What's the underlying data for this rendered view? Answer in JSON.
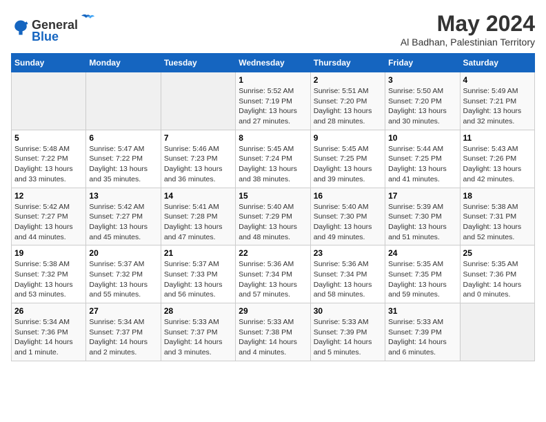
{
  "header": {
    "logo_general": "General",
    "logo_blue": "Blue",
    "month_year": "May 2024",
    "location": "Al Badhan, Palestinian Territory"
  },
  "days_of_week": [
    "Sunday",
    "Monday",
    "Tuesday",
    "Wednesday",
    "Thursday",
    "Friday",
    "Saturday"
  ],
  "weeks": [
    [
      {
        "day": "",
        "sunrise": "",
        "sunset": "",
        "daylight": ""
      },
      {
        "day": "",
        "sunrise": "",
        "sunset": "",
        "daylight": ""
      },
      {
        "day": "",
        "sunrise": "",
        "sunset": "",
        "daylight": ""
      },
      {
        "day": "1",
        "sunrise": "Sunrise: 5:52 AM",
        "sunset": "Sunset: 7:19 PM",
        "daylight": "Daylight: 13 hours and 27 minutes."
      },
      {
        "day": "2",
        "sunrise": "Sunrise: 5:51 AM",
        "sunset": "Sunset: 7:20 PM",
        "daylight": "Daylight: 13 hours and 28 minutes."
      },
      {
        "day": "3",
        "sunrise": "Sunrise: 5:50 AM",
        "sunset": "Sunset: 7:20 PM",
        "daylight": "Daylight: 13 hours and 30 minutes."
      },
      {
        "day": "4",
        "sunrise": "Sunrise: 5:49 AM",
        "sunset": "Sunset: 7:21 PM",
        "daylight": "Daylight: 13 hours and 32 minutes."
      }
    ],
    [
      {
        "day": "5",
        "sunrise": "Sunrise: 5:48 AM",
        "sunset": "Sunset: 7:22 PM",
        "daylight": "Daylight: 13 hours and 33 minutes."
      },
      {
        "day": "6",
        "sunrise": "Sunrise: 5:47 AM",
        "sunset": "Sunset: 7:22 PM",
        "daylight": "Daylight: 13 hours and 35 minutes."
      },
      {
        "day": "7",
        "sunrise": "Sunrise: 5:46 AM",
        "sunset": "Sunset: 7:23 PM",
        "daylight": "Daylight: 13 hours and 36 minutes."
      },
      {
        "day": "8",
        "sunrise": "Sunrise: 5:45 AM",
        "sunset": "Sunset: 7:24 PM",
        "daylight": "Daylight: 13 hours and 38 minutes."
      },
      {
        "day": "9",
        "sunrise": "Sunrise: 5:45 AM",
        "sunset": "Sunset: 7:25 PM",
        "daylight": "Daylight: 13 hours and 39 minutes."
      },
      {
        "day": "10",
        "sunrise": "Sunrise: 5:44 AM",
        "sunset": "Sunset: 7:25 PM",
        "daylight": "Daylight: 13 hours and 41 minutes."
      },
      {
        "day": "11",
        "sunrise": "Sunrise: 5:43 AM",
        "sunset": "Sunset: 7:26 PM",
        "daylight": "Daylight: 13 hours and 42 minutes."
      }
    ],
    [
      {
        "day": "12",
        "sunrise": "Sunrise: 5:42 AM",
        "sunset": "Sunset: 7:27 PM",
        "daylight": "Daylight: 13 hours and 44 minutes."
      },
      {
        "day": "13",
        "sunrise": "Sunrise: 5:42 AM",
        "sunset": "Sunset: 7:27 PM",
        "daylight": "Daylight: 13 hours and 45 minutes."
      },
      {
        "day": "14",
        "sunrise": "Sunrise: 5:41 AM",
        "sunset": "Sunset: 7:28 PM",
        "daylight": "Daylight: 13 hours and 47 minutes."
      },
      {
        "day": "15",
        "sunrise": "Sunrise: 5:40 AM",
        "sunset": "Sunset: 7:29 PM",
        "daylight": "Daylight: 13 hours and 48 minutes."
      },
      {
        "day": "16",
        "sunrise": "Sunrise: 5:40 AM",
        "sunset": "Sunset: 7:30 PM",
        "daylight": "Daylight: 13 hours and 49 minutes."
      },
      {
        "day": "17",
        "sunrise": "Sunrise: 5:39 AM",
        "sunset": "Sunset: 7:30 PM",
        "daylight": "Daylight: 13 hours and 51 minutes."
      },
      {
        "day": "18",
        "sunrise": "Sunrise: 5:38 AM",
        "sunset": "Sunset: 7:31 PM",
        "daylight": "Daylight: 13 hours and 52 minutes."
      }
    ],
    [
      {
        "day": "19",
        "sunrise": "Sunrise: 5:38 AM",
        "sunset": "Sunset: 7:32 PM",
        "daylight": "Daylight: 13 hours and 53 minutes."
      },
      {
        "day": "20",
        "sunrise": "Sunrise: 5:37 AM",
        "sunset": "Sunset: 7:32 PM",
        "daylight": "Daylight: 13 hours and 55 minutes."
      },
      {
        "day": "21",
        "sunrise": "Sunrise: 5:37 AM",
        "sunset": "Sunset: 7:33 PM",
        "daylight": "Daylight: 13 hours and 56 minutes."
      },
      {
        "day": "22",
        "sunrise": "Sunrise: 5:36 AM",
        "sunset": "Sunset: 7:34 PM",
        "daylight": "Daylight: 13 hours and 57 minutes."
      },
      {
        "day": "23",
        "sunrise": "Sunrise: 5:36 AM",
        "sunset": "Sunset: 7:34 PM",
        "daylight": "Daylight: 13 hours and 58 minutes."
      },
      {
        "day": "24",
        "sunrise": "Sunrise: 5:35 AM",
        "sunset": "Sunset: 7:35 PM",
        "daylight": "Daylight: 13 hours and 59 minutes."
      },
      {
        "day": "25",
        "sunrise": "Sunrise: 5:35 AM",
        "sunset": "Sunset: 7:36 PM",
        "daylight": "Daylight: 14 hours and 0 minutes."
      }
    ],
    [
      {
        "day": "26",
        "sunrise": "Sunrise: 5:34 AM",
        "sunset": "Sunset: 7:36 PM",
        "daylight": "Daylight: 14 hours and 1 minute."
      },
      {
        "day": "27",
        "sunrise": "Sunrise: 5:34 AM",
        "sunset": "Sunset: 7:37 PM",
        "daylight": "Daylight: 14 hours and 2 minutes."
      },
      {
        "day": "28",
        "sunrise": "Sunrise: 5:33 AM",
        "sunset": "Sunset: 7:37 PM",
        "daylight": "Daylight: 14 hours and 3 minutes."
      },
      {
        "day": "29",
        "sunrise": "Sunrise: 5:33 AM",
        "sunset": "Sunset: 7:38 PM",
        "daylight": "Daylight: 14 hours and 4 minutes."
      },
      {
        "day": "30",
        "sunrise": "Sunrise: 5:33 AM",
        "sunset": "Sunset: 7:39 PM",
        "daylight": "Daylight: 14 hours and 5 minutes."
      },
      {
        "day": "31",
        "sunrise": "Sunrise: 5:33 AM",
        "sunset": "Sunset: 7:39 PM",
        "daylight": "Daylight: 14 hours and 6 minutes."
      },
      {
        "day": "",
        "sunrise": "",
        "sunset": "",
        "daylight": ""
      }
    ]
  ]
}
